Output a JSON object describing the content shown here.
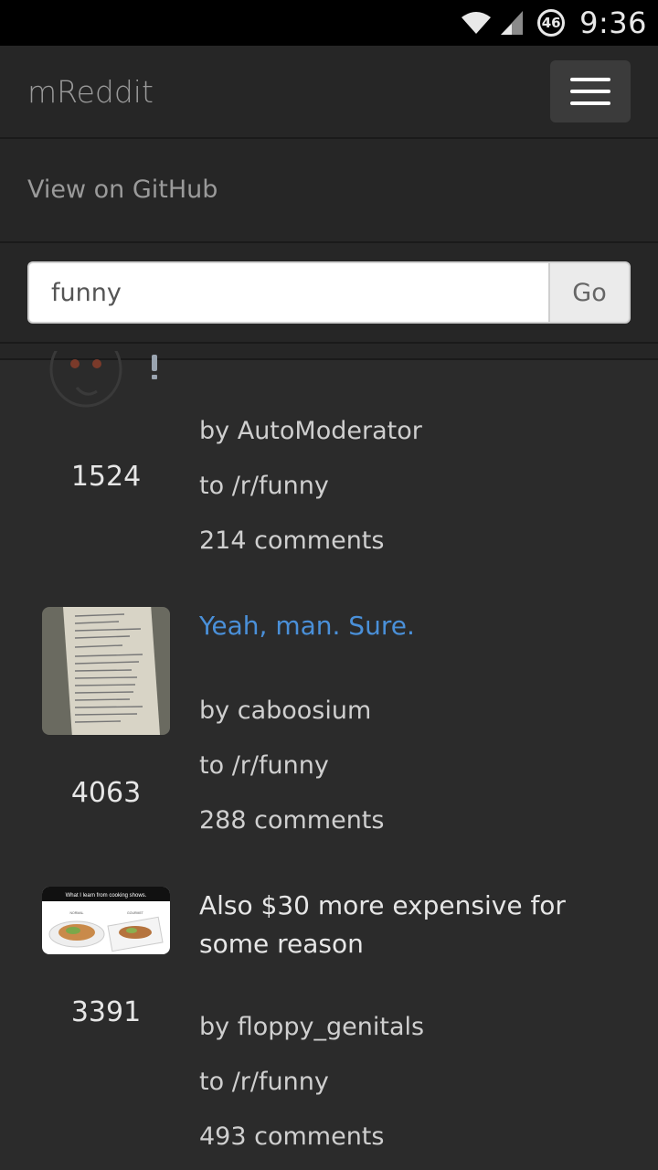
{
  "status_bar": {
    "badge": "46",
    "time": "9:36"
  },
  "navbar": {
    "brand": "mReddit",
    "github_link": "View on GitHub"
  },
  "search": {
    "value": "funny",
    "go_label": "Go"
  },
  "colors": {
    "link": "#4a90d9",
    "background": "#2b2b2b",
    "navbar": "#262626"
  },
  "posts": [
    {
      "score": "1524",
      "thumbnail": "reddit-alien-icon",
      "by_prefix": "by",
      "author": "AutoModerator",
      "to_prefix": "to",
      "subreddit": "/r/funny",
      "comments": "214 comments"
    },
    {
      "score": "4063",
      "thumbnail": "pizza-receipt-image",
      "title": "Yeah, man. Sure.",
      "by_prefix": "by",
      "author": "caboosium",
      "to_prefix": "to",
      "subreddit": "/r/funny",
      "comments": "288 comments"
    },
    {
      "score": "3391",
      "thumbnail": "cooking-shows-image",
      "thumbnail_caption": "What I learn from cooking shows.",
      "thumbnail_left": "NORMAL",
      "thumbnail_right": "GOURMET",
      "title": "Also $30 more expensive for some reason",
      "by_prefix": "by",
      "author": "floppy_genitals",
      "to_prefix": "to",
      "subreddit": "/r/funny",
      "comments": "493 comments"
    }
  ]
}
